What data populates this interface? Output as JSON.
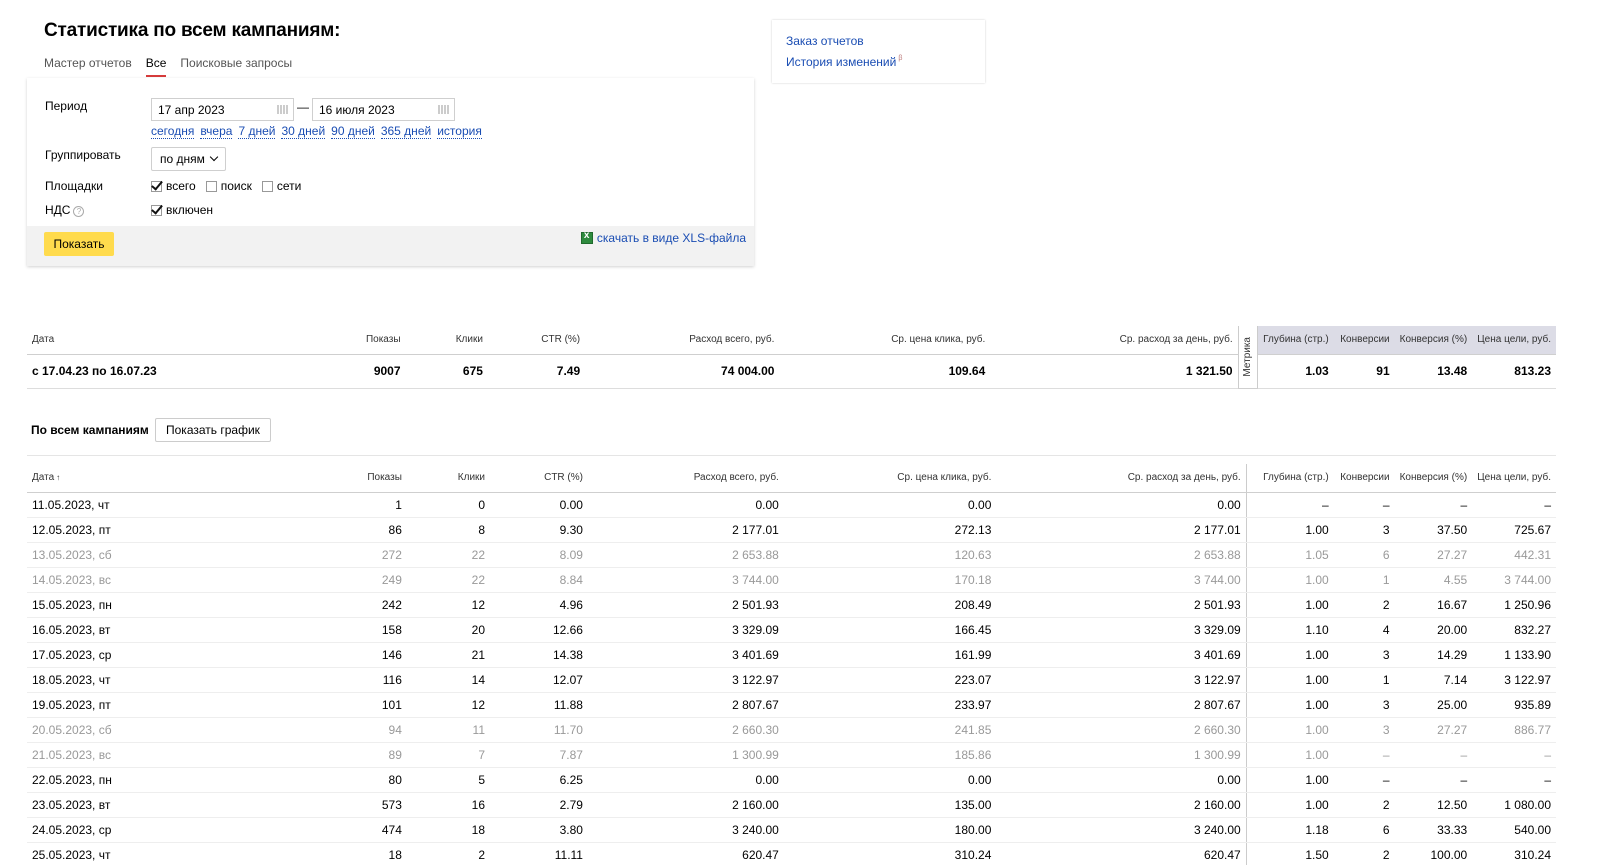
{
  "page": {
    "title": "Статистика по всем кампаниям:"
  },
  "subtabs": [
    {
      "label": "Мастер отчетов",
      "active": false
    },
    {
      "label": "Все",
      "active": true
    },
    {
      "label": "Поисковые запросы",
      "active": false
    }
  ],
  "form": {
    "period_label": "Период",
    "date_from": "17 апр 2023",
    "date_to": "16 июля 2023",
    "dash": "—",
    "quick_links": [
      "сегодня",
      "вчера",
      "7 дней",
      "30 дней",
      "90 дней",
      "365 дней",
      "история"
    ],
    "group_label": "Группировать",
    "group_value": "по дням",
    "platforms_label": "Площадки",
    "platforms": [
      {
        "label": "всего",
        "checked": true
      },
      {
        "label": "поиск",
        "checked": false
      },
      {
        "label": "сети",
        "checked": false
      }
    ],
    "vat_label": "НДС",
    "vat_help": "?",
    "vat_option": {
      "label": "включен",
      "checked": true
    },
    "show_button": "Показать",
    "xls_link": "скачать в виде XLS-файла"
  },
  "side_links": {
    "order_reports": "Заказ отчетов",
    "history": "История изменений",
    "history_badge": "β"
  },
  "summary": {
    "headers": [
      "Дата",
      "Показы",
      "Клики",
      "CTR (%)",
      "Расход всего, руб.",
      "Ср. цена клика, руб.",
      "Ср. расход за день, руб.",
      "Глубина (стр.)",
      "Конверсии",
      "Конверсия (%)",
      "Цена цели, руб."
    ],
    "metrika_label": "Метрика",
    "row": [
      "с 17.04.23 по 16.07.23",
      "9007",
      "675",
      "7.49",
      "74 004.00",
      "109.64",
      "1 321.50",
      "1.03",
      "91",
      "13.48",
      "813.23"
    ]
  },
  "section": {
    "title": "По всем кампаниям",
    "chart_button": "Показать график"
  },
  "daily": {
    "headers": [
      "Дата",
      "Показы",
      "Клики",
      "CTR (%)",
      "Расход всего, руб.",
      "Ср. цена клика, руб.",
      "Ср. расход за день, руб.",
      "Глубина (стр.)",
      "Конверсии",
      "Конверсия (%)",
      "Цена цели, руб."
    ],
    "sort_indicator": "↑",
    "rows": [
      {
        "muted": false,
        "cells": [
          "11.05.2023, чт",
          "1",
          "0",
          "0.00",
          "0.00",
          "0.00",
          "0.00",
          "–",
          "–",
          "–",
          "–"
        ]
      },
      {
        "muted": false,
        "cells": [
          "12.05.2023, пт",
          "86",
          "8",
          "9.30",
          "2 177.01",
          "272.13",
          "2 177.01",
          "1.00",
          "3",
          "37.50",
          "725.67"
        ]
      },
      {
        "muted": true,
        "cells": [
          "13.05.2023, сб",
          "272",
          "22",
          "8.09",
          "2 653.88",
          "120.63",
          "2 653.88",
          "1.05",
          "6",
          "27.27",
          "442.31"
        ]
      },
      {
        "muted": true,
        "cells": [
          "14.05.2023, вс",
          "249",
          "22",
          "8.84",
          "3 744.00",
          "170.18",
          "3 744.00",
          "1.00",
          "1",
          "4.55",
          "3 744.00"
        ]
      },
      {
        "muted": false,
        "cells": [
          "15.05.2023, пн",
          "242",
          "12",
          "4.96",
          "2 501.93",
          "208.49",
          "2 501.93",
          "1.00",
          "2",
          "16.67",
          "1 250.96"
        ]
      },
      {
        "muted": false,
        "cells": [
          "16.05.2023, вт",
          "158",
          "20",
          "12.66",
          "3 329.09",
          "166.45",
          "3 329.09",
          "1.10",
          "4",
          "20.00",
          "832.27"
        ]
      },
      {
        "muted": false,
        "cells": [
          "17.05.2023, ср",
          "146",
          "21",
          "14.38",
          "3 401.69",
          "161.99",
          "3 401.69",
          "1.00",
          "3",
          "14.29",
          "1 133.90"
        ]
      },
      {
        "muted": false,
        "cells": [
          "18.05.2023, чт",
          "116",
          "14",
          "12.07",
          "3 122.97",
          "223.07",
          "3 122.97",
          "1.00",
          "1",
          "7.14",
          "3 122.97"
        ]
      },
      {
        "muted": false,
        "cells": [
          "19.05.2023, пт",
          "101",
          "12",
          "11.88",
          "2 807.67",
          "233.97",
          "2 807.67",
          "1.00",
          "3",
          "25.00",
          "935.89"
        ]
      },
      {
        "muted": true,
        "cells": [
          "20.05.2023, сб",
          "94",
          "11",
          "11.70",
          "2 660.30",
          "241.85",
          "2 660.30",
          "1.00",
          "3",
          "27.27",
          "886.77"
        ]
      },
      {
        "muted": true,
        "cells": [
          "21.05.2023, вс",
          "89",
          "7",
          "7.87",
          "1 300.99",
          "185.86",
          "1 300.99",
          "1.00",
          "–",
          "–",
          "–"
        ]
      },
      {
        "muted": false,
        "cells": [
          "22.05.2023, пн",
          "80",
          "5",
          "6.25",
          "0.00",
          "0.00",
          "0.00",
          "1.00",
          "–",
          "–",
          "–"
        ]
      },
      {
        "muted": false,
        "cells": [
          "23.05.2023, вт",
          "573",
          "16",
          "2.79",
          "2 160.00",
          "135.00",
          "2 160.00",
          "1.00",
          "2",
          "12.50",
          "1 080.00"
        ]
      },
      {
        "muted": false,
        "cells": [
          "24.05.2023, ср",
          "474",
          "18",
          "3.80",
          "3 240.00",
          "180.00",
          "3 240.00",
          "1.18",
          "6",
          "33.33",
          "540.00"
        ]
      },
      {
        "muted": false,
        "cells": [
          "25.05.2023, чт",
          "18",
          "2",
          "11.11",
          "620.47",
          "310.24",
          "620.47",
          "1.50",
          "2",
          "100.00",
          "310.24"
        ]
      }
    ]
  }
}
